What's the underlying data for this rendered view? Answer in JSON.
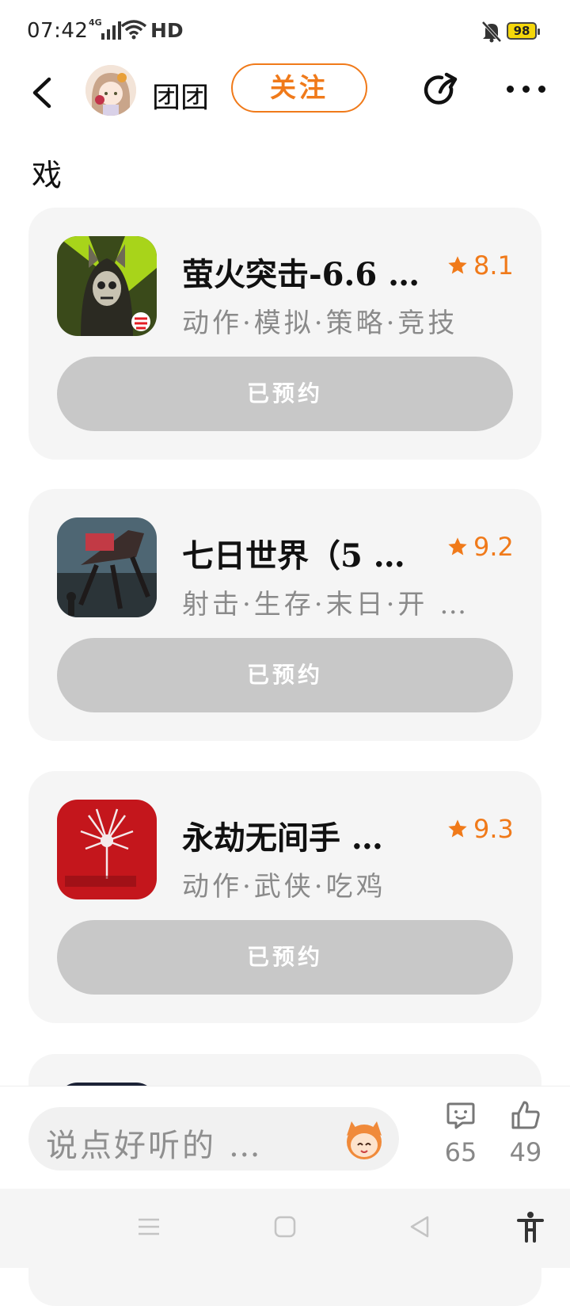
{
  "status_bar": {
    "time": "07:42",
    "network": "4G",
    "hd": "HD",
    "battery": "98"
  },
  "header": {
    "username": "团团",
    "follow_label": "关注"
  },
  "section_title": "戏",
  "games": [
    {
      "name": "萤火突击-6.6 …",
      "rating": "8.1",
      "tags": "动作·模拟·策略·竞技",
      "reserve_label": "已预约"
    },
    {
      "name": "七日世界（5 …",
      "rating": "9.2",
      "tags": "射击·生存·末日·开 …",
      "reserve_label": "已预约"
    },
    {
      "name": "永劫无间手 …",
      "rating": "9.3",
      "tags": "动作·武侠·吃鸡",
      "reserve_label": "已预约"
    }
  ],
  "comment_bar": {
    "placeholder": "说点好听的 …",
    "comments_count": "65",
    "likes_count": "49"
  },
  "colors": {
    "accent": "#f07a1a",
    "card_bg": "#f5f5f5",
    "reserve_bg": "#c8c8c8"
  }
}
